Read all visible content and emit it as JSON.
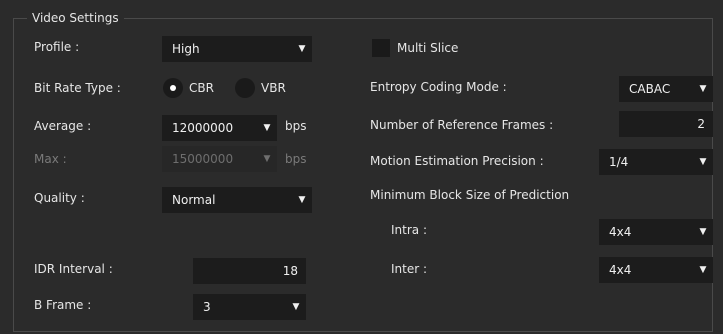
{
  "group": {
    "title": "Video Settings"
  },
  "profile": {
    "label": "Profile :",
    "value": "High"
  },
  "bit_rate_type": {
    "label": "Bit Rate Type :",
    "options": [
      "CBR",
      "VBR"
    ],
    "selected": "CBR"
  },
  "average": {
    "label": "Average :",
    "value": "12000000",
    "unit": "bps"
  },
  "max": {
    "label": "Max :",
    "value": "15000000",
    "unit": "bps"
  },
  "quality": {
    "label": "Quality :",
    "value": "Normal"
  },
  "idr_interval": {
    "label": "IDR Interval :",
    "value": "18"
  },
  "b_frame": {
    "label": "B Frame :",
    "value": "3"
  },
  "multi_slice": {
    "label": "Multi Slice",
    "checked": false
  },
  "entropy": {
    "label": "Entropy Coding Mode :",
    "value": "CABAC"
  },
  "ref_frames": {
    "label": "Number of Reference Frames :",
    "value": "2"
  },
  "motion": {
    "label": "Motion Estimation Precision :",
    "value": "1/4"
  },
  "min_block": {
    "label": "Minimum Block Size of Prediction",
    "intra": {
      "label": "Intra :",
      "value": "4x4"
    },
    "inter": {
      "label": "Inter :",
      "value": "4x4"
    }
  },
  "icons": {
    "dropdown": "chevron-down-icon",
    "radio_selected": "radio-dot"
  }
}
